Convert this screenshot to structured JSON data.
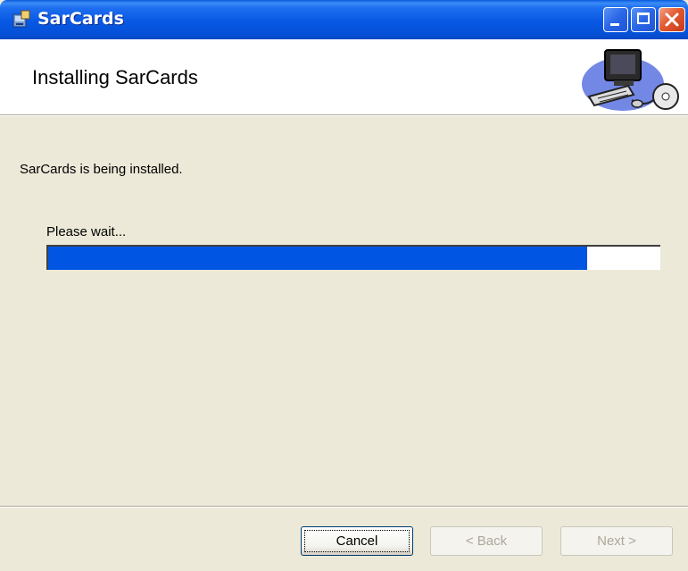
{
  "window": {
    "title": "SarCards",
    "controls": {
      "minimize_icon": "minimize-icon",
      "maximize_icon": "maximize-icon",
      "close_icon": "close-icon"
    }
  },
  "header": {
    "title": "Installing SarCards",
    "image_icon": "computer-icon"
  },
  "body": {
    "status": "SarCards is being installed.",
    "wait_label": "Please wait...",
    "progress_percent": 88
  },
  "buttons": {
    "cancel": "Cancel",
    "back": "< Back",
    "next": "Next >"
  },
  "colors": {
    "progress_fill": "#0055e3",
    "titlebar": "#0858e4",
    "background": "#ece9d8"
  }
}
